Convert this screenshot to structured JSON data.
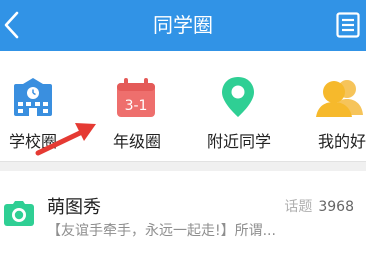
{
  "header": {
    "title": "同学圈",
    "back_icon": "chevron-left-icon",
    "menu_icon": "list-menu-icon",
    "bg_color": "#3193e6"
  },
  "categories": [
    {
      "label": "学校圈",
      "icon": "school-building-icon",
      "color": "#3a8fdf"
    },
    {
      "label": "年级圈",
      "icon": "calendar-3-1-icon",
      "icon_text": "3-1",
      "color": "#ee6f6d"
    },
    {
      "label": "附近同学",
      "icon": "location-pin-icon",
      "color": "#2fcf94"
    },
    {
      "label": "我的好友",
      "icon": "friends-icon",
      "color": "#f6b92c"
    }
  ],
  "annotation": {
    "icon": "red-arrow-icon",
    "color": "#e53a33"
  },
  "list": [
    {
      "title": "萌图秀",
      "topic_label": "话题",
      "topic_count": "3968",
      "description": "【友谊手牵手，永远一起走!】所谓...",
      "icon": "camera-icon",
      "icon_color": "#2fcf94"
    }
  ]
}
